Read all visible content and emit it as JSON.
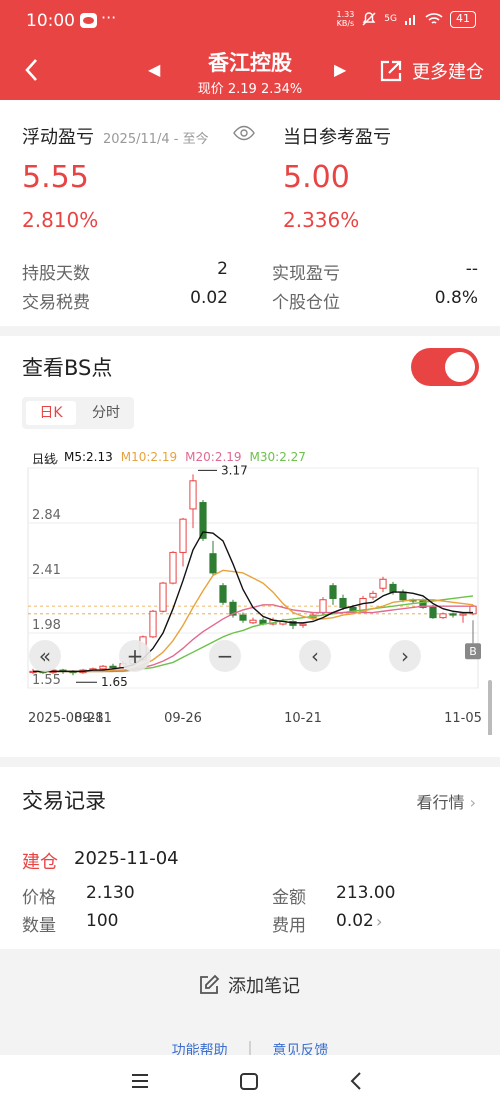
{
  "status": {
    "time": "10:00",
    "dots": "···",
    "net_top": "1.33",
    "net_bottom": "KB/s",
    "net_type": "5G",
    "battery": "41"
  },
  "header": {
    "title": "香江控股",
    "subtitle": "现价 2.19 2.34%",
    "more": "更多建仓"
  },
  "summary": {
    "float_label": "浮动盈亏",
    "float_period": "2025/11/4 - 至今",
    "float_value": "5.55",
    "float_pct": "2.810%",
    "day_label": "当日参考盈亏",
    "day_value": "5.00",
    "day_pct": "2.336%",
    "hold_days_label": "持股天数",
    "hold_days": "2",
    "tax_label": "交易税费",
    "tax": "0.02",
    "realized_label": "实现盈亏",
    "realized": "--",
    "position_label": "个股仓位",
    "position": "0.8%"
  },
  "bs": {
    "title": "查看BS点",
    "tab_day": "日K",
    "tab_min": "分时",
    "period": "日线",
    "ma5": "M5:2.13",
    "ma10": "M10:2.19",
    "ma20": "M20:2.19",
    "ma30": "M30:2.27",
    "colors": {
      "up": "#e94444",
      "down": "#2e7d32",
      "ma5": "#111111",
      "ma10": "#e8a33c",
      "ma20": "#e06a8f",
      "ma30": "#6cc24a"
    }
  },
  "chart_data": {
    "type": "candlestick",
    "y_ticks": [
      "3.27",
      "2.84",
      "2.41",
      "1.98",
      "1.55"
    ],
    "ylim": [
      1.55,
      3.27
    ],
    "x_ticks": [
      "2025-08-28",
      "09-11",
      "09-26",
      "10-21",
      "11-05"
    ],
    "annotations": {
      "high": "3.17",
      "low": "1.65",
      "marker": "B"
    },
    "candles": [
      [
        1.68,
        1.68,
        1.7,
        1.66
      ],
      [
        1.68,
        1.67,
        1.69,
        1.66
      ],
      [
        1.67,
        1.69,
        1.7,
        1.66
      ],
      [
        1.69,
        1.68,
        1.7,
        1.66
      ],
      [
        1.68,
        1.67,
        1.69,
        1.65
      ],
      [
        1.67,
        1.69,
        1.7,
        1.66
      ],
      [
        1.69,
        1.7,
        1.71,
        1.68
      ],
      [
        1.7,
        1.72,
        1.73,
        1.69
      ],
      [
        1.72,
        1.71,
        1.74,
        1.7
      ],
      [
        1.71,
        1.74,
        1.76,
        1.7
      ],
      [
        1.74,
        1.77,
        1.79,
        1.73
      ],
      [
        1.77,
        1.95,
        1.96,
        1.76
      ],
      [
        1.95,
        2.15,
        2.16,
        1.94
      ],
      [
        2.15,
        2.37,
        2.38,
        2.14
      ],
      [
        2.37,
        2.61,
        2.62,
        2.36
      ],
      [
        2.61,
        2.87,
        2.88,
        2.5
      ],
      [
        2.95,
        3.17,
        3.22,
        2.8
      ],
      [
        3.0,
        2.72,
        3.02,
        2.7
      ],
      [
        2.6,
        2.45,
        2.7,
        2.43
      ],
      [
        2.35,
        2.22,
        2.37,
        2.2
      ],
      [
        2.22,
        2.12,
        2.24,
        2.1
      ],
      [
        2.12,
        2.08,
        2.14,
        2.06
      ],
      [
        2.06,
        2.08,
        2.1,
        2.05
      ],
      [
        2.08,
        2.05,
        2.1,
        2.04
      ],
      [
        2.05,
        2.08,
        2.1,
        2.04
      ],
      [
        2.05,
        2.07,
        2.09,
        2.04
      ],
      [
        2.07,
        2.04,
        2.08,
        2.01
      ],
      [
        2.04,
        2.05,
        2.06,
        2.02
      ],
      [
        2.1,
        2.12,
        2.14,
        2.08
      ],
      [
        2.14,
        2.24,
        2.26,
        2.12
      ],
      [
        2.35,
        2.25,
        2.37,
        2.2
      ],
      [
        2.25,
        2.18,
        2.28,
        2.16
      ],
      [
        2.18,
        2.15,
        2.2,
        2.13
      ],
      [
        2.15,
        2.25,
        2.27,
        2.14
      ],
      [
        2.26,
        2.29,
        2.31,
        2.24
      ],
      [
        2.33,
        2.4,
        2.42,
        2.3
      ],
      [
        2.36,
        2.3,
        2.38,
        2.28
      ],
      [
        2.3,
        2.24,
        2.32,
        2.22
      ],
      [
        2.24,
        2.23,
        2.25,
        2.21
      ],
      [
        2.23,
        2.18,
        2.25,
        2.17
      ],
      [
        2.18,
        2.1,
        2.2,
        2.09
      ],
      [
        2.1,
        2.13,
        2.14,
        2.09
      ],
      [
        2.13,
        2.12,
        2.14,
        2.1
      ],
      [
        2.12,
        2.13,
        2.14,
        2.06
      ],
      [
        2.13,
        2.19,
        2.2,
        2.12
      ]
    ],
    "ma": {
      "ma5": [
        1.68,
        1.68,
        1.68,
        1.68,
        1.68,
        1.68,
        1.69,
        1.69,
        1.7,
        1.71,
        1.73,
        1.78,
        1.86,
        1.98,
        2.17,
        2.39,
        2.63,
        2.77,
        2.76,
        2.7,
        2.52,
        2.32,
        2.18,
        2.11,
        2.08,
        2.07,
        2.06,
        2.06,
        2.07,
        2.1,
        2.14,
        2.17,
        2.19,
        2.21,
        2.22,
        2.27,
        2.3,
        2.3,
        2.29,
        2.27,
        2.21,
        2.17,
        2.15,
        2.14,
        2.14
      ],
      "ma10": [
        1.68,
        1.68,
        1.68,
        1.68,
        1.68,
        1.68,
        1.68,
        1.68,
        1.69,
        1.69,
        1.7,
        1.73,
        1.77,
        1.83,
        1.92,
        2.04,
        2.18,
        2.31,
        2.43,
        2.47,
        2.46,
        2.45,
        2.41,
        2.37,
        2.3,
        2.21,
        2.14,
        2.11,
        2.09,
        2.09,
        2.1,
        2.12,
        2.13,
        2.15,
        2.17,
        2.19,
        2.22,
        2.23,
        2.24,
        2.24,
        2.24,
        2.23,
        2.22,
        2.21,
        2.2
      ],
      "ma20": [
        1.68,
        1.68,
        1.68,
        1.68,
        1.68,
        1.68,
        1.68,
        1.68,
        1.68,
        1.69,
        1.69,
        1.71,
        1.73,
        1.76,
        1.8,
        1.86,
        1.93,
        1.99,
        2.04,
        2.09,
        2.13,
        2.16,
        2.18,
        2.2,
        2.2,
        2.18,
        2.16,
        2.15,
        2.14,
        2.14,
        2.14,
        2.14,
        2.14,
        2.14,
        2.14,
        2.15,
        2.16,
        2.17,
        2.18,
        2.19,
        2.19,
        2.19,
        2.19,
        2.19,
        2.19
      ],
      "ma30": [
        1.68,
        1.68,
        1.68,
        1.68,
        1.68,
        1.68,
        1.68,
        1.68,
        1.68,
        1.68,
        1.69,
        1.7,
        1.71,
        1.73,
        1.75,
        1.79,
        1.83,
        1.87,
        1.91,
        1.95,
        1.98,
        2.0,
        2.03,
        2.05,
        2.06,
        2.08,
        2.09,
        2.1,
        2.11,
        2.12,
        2.13,
        2.14,
        2.15,
        2.16,
        2.17,
        2.18,
        2.19,
        2.2,
        2.21,
        2.22,
        2.23,
        2.24,
        2.25,
        2.26,
        2.27
      ]
    }
  },
  "chart_controls": [
    "«",
    "+",
    "−",
    "‹",
    "›"
  ],
  "trade": {
    "title": "交易记录",
    "link": "看行情",
    "type": "建仓",
    "date": "2025-11-04",
    "price_label": "价格",
    "price": "2.130",
    "qty_label": "数量",
    "qty": "100",
    "amount_label": "金额",
    "amount": "213.00",
    "fee_label": "费用",
    "fee": "0.02"
  },
  "note_button": "添加笔记",
  "footer_links": [
    "功能帮助",
    "意见反馈"
  ]
}
